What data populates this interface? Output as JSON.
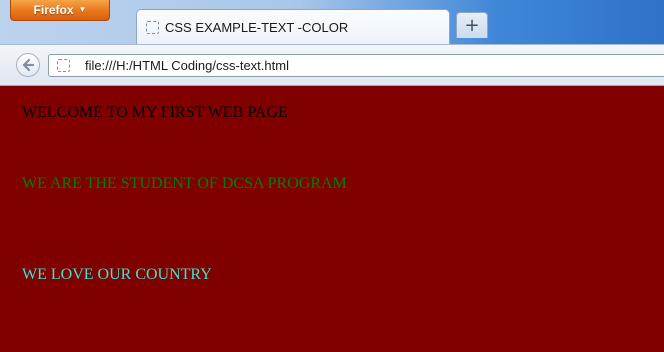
{
  "browser": {
    "menu_button_label": "Firefox",
    "menu_button_icon": "chevron-down-icon",
    "tab": {
      "title": "CSS EXAMPLE-TEXT -COLOR",
      "favicon": "blank-page-icon"
    },
    "new_tab_label": "+",
    "nav": {
      "back_icon": "arrow-left-icon",
      "site_icon": "blank-page-icon",
      "url": "file:///H:/HTML Coding/css-text.html"
    }
  },
  "page": {
    "background_color": "#800000",
    "lines": [
      {
        "text": "WELCOME TO MY FIRST WEB PAGE",
        "color": "#000000"
      },
      {
        "text": "WE ARE THE STUDENT OF DCSA PROGRAM",
        "color": "#008000"
      },
      {
        "text": "WE LOVE OUR COUNTRY",
        "color": "#40e0d0"
      }
    ]
  }
}
